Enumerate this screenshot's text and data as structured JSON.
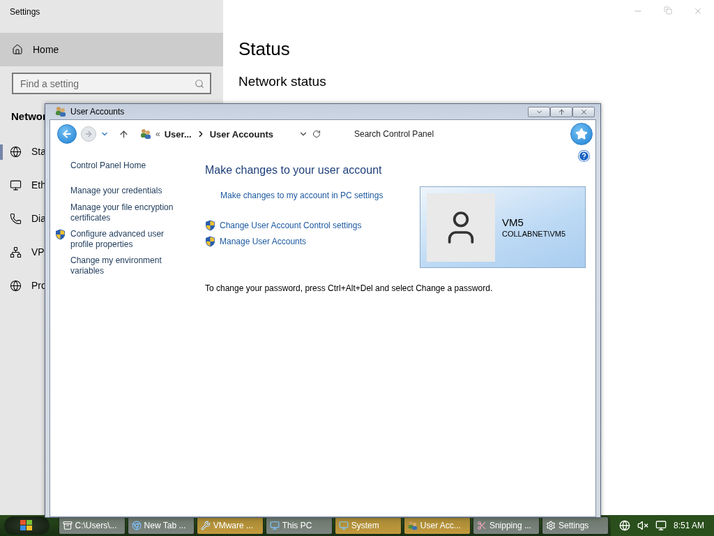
{
  "settings": {
    "title": "Settings",
    "home": "Home",
    "search": {
      "placeholder": "Find a setting"
    },
    "section_heading": "Networ",
    "nav_items": [
      {
        "label": "Sta",
        "selected": true
      },
      {
        "label": "Eth",
        "selected": false
      },
      {
        "label": "Dia",
        "selected": false
      },
      {
        "label": "VP",
        "selected": false
      },
      {
        "label": "Pro",
        "selected": false
      }
    ],
    "page_title": "Status",
    "subheading": "Network status"
  },
  "dialog": {
    "title": "User Accounts",
    "overflow": "«",
    "breadcrumb": [
      "User...",
      "User Accounts"
    ],
    "search": {
      "placeholder": "Search Control Panel"
    },
    "sidebar": [
      {
        "label": "Control Panel Home",
        "shield": false
      },
      {
        "label": "Manage your credentials",
        "shield": false
      },
      {
        "label": "Manage your file encryption certificates",
        "shield": false
      },
      {
        "label": "Configure advanced user profile properties",
        "shield": true
      },
      {
        "label": "Change my environment variables",
        "shield": false
      }
    ],
    "heading": "Make changes to your user account",
    "links": [
      {
        "label": "Make changes to my account in PC settings",
        "shield": false
      },
      {
        "label": "Change User Account Control settings",
        "shield": true
      },
      {
        "label": "Manage User Accounts",
        "shield": true
      }
    ],
    "user": {
      "name": "VM5",
      "account": "COLLABNET\\VM5"
    },
    "note": "To change your password, press Ctrl+Alt+Del and select Change a password."
  },
  "taskbar": {
    "items": [
      {
        "label": "C:\\Users\\...",
        "color": "#7d8580"
      },
      {
        "label": "New Tab ...",
        "color": "#7d8580"
      },
      {
        "label": "VMware ...",
        "color": "#c49a3c"
      },
      {
        "label": "This PC",
        "color": "#7d8580"
      },
      {
        "label": "System",
        "color": "#c49a3c"
      },
      {
        "label": "User Acc...",
        "color": "#c49a3c"
      },
      {
        "label": "Snipping ...",
        "color": "#7d8580"
      },
      {
        "label": "Settings",
        "color": "#7d8580"
      }
    ],
    "time": "8:51 AM"
  }
}
